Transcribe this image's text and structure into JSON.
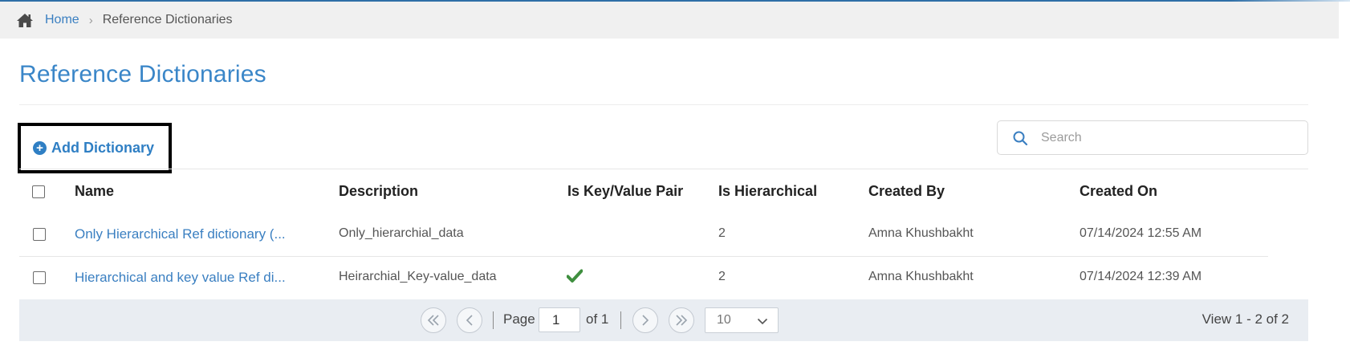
{
  "breadcrumb": {
    "home_icon": "home-icon",
    "home_label": "Home",
    "separator": "›",
    "current": "Reference Dictionaries"
  },
  "page": {
    "title": "Reference Dictionaries"
  },
  "toolbar": {
    "add_icon": "plus-circle-icon",
    "add_label": "Add Dictionary",
    "search_icon": "search-icon",
    "search_placeholder": "Search",
    "search_value": ""
  },
  "table": {
    "columns": [
      "Name",
      "Description",
      "Is Key/Value Pair",
      "Is Hierarchical",
      "Created By",
      "Created On"
    ],
    "rows": [
      {
        "name": "Only Hierarchical Ref dictionary (...",
        "description": "Only_hierarchial_data",
        "is_key_value": false,
        "is_hierarchical": "2",
        "created_by": "Amna Khushbakht",
        "created_on": "07/14/2024 12:55 AM"
      },
      {
        "name": "Hierarchical and key value Ref di...",
        "description": "Heirarchial_Key-value_data",
        "is_key_value": true,
        "is_hierarchical": "2",
        "created_by": "Amna Khushbakht",
        "created_on": "07/14/2024 12:39 AM"
      }
    ]
  },
  "pager": {
    "page_label": "Page",
    "page_value": "1",
    "of_label": "of 1",
    "page_size": "10",
    "view_label": "View 1 - 2 of 2"
  },
  "colors": {
    "accent": "#3a7fc1",
    "title": "#3a86c8",
    "check_green": "#3f8f3f",
    "pager_bg": "#e9edf2",
    "breadcrumb_bg": "#f0f0f0"
  }
}
